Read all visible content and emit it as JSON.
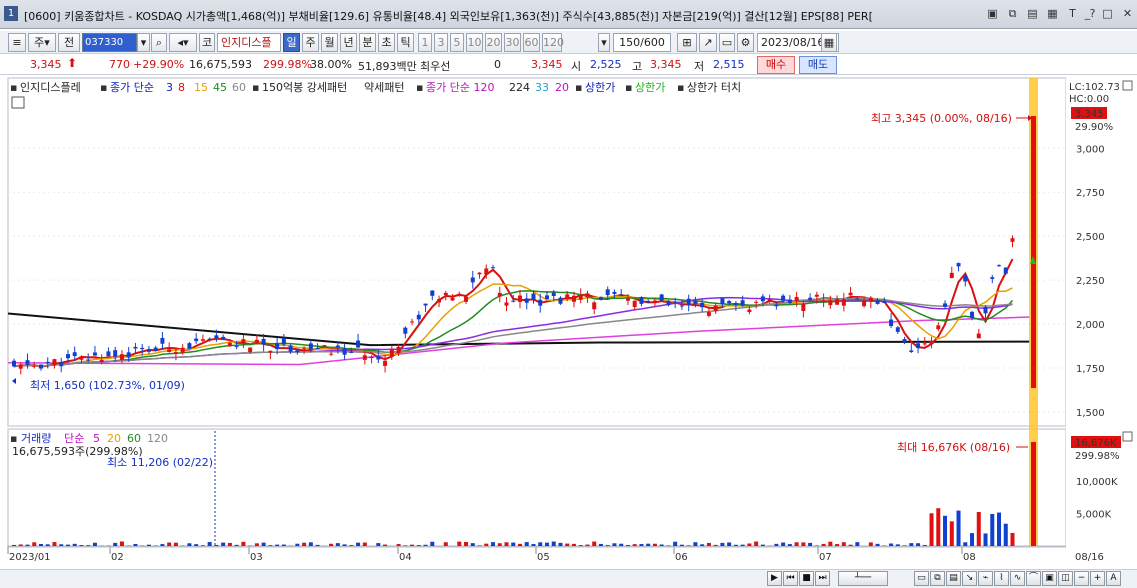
{
  "window": {
    "number": "1",
    "title": "[0600] 키움종합차트 - KOSDAQ 시가총액[1,468(억)] 부채비율[129.6] 유통비율[48.4] 외국인보유[1,363(천)] 주식수[43,885(천)] 자본금[219(억)] 결산[12월] EPS[88] PER["
  },
  "toolbar": {
    "week_label": "주",
    "prev_label": "전",
    "code": "037330",
    "market_label": "코",
    "stock_name": "인지디스플",
    "periods": [
      "일",
      "주",
      "월",
      "년",
      "분",
      "초",
      "틱"
    ],
    "active_period": "일",
    "minute_steps": [
      "1",
      "3",
      "5",
      "10",
      "20",
      "30",
      "60",
      "120"
    ],
    "count": "150/600",
    "date": "2023/08/16"
  },
  "price_row": {
    "price": "3,345",
    "change": "770",
    "change_pct": "+29.90%",
    "volume": "16,675,593",
    "volume_ratio": "299.98%",
    "turnover": "38.00%",
    "amount": "51,893백만",
    "preferred_label": "최우선",
    "preferred_value": "0",
    "ask": "3,345",
    "open_label": "시",
    "open": "2,525",
    "high_label": "고",
    "high": "3,345",
    "low_label": "저",
    "low": "2,515",
    "buy_label": "매수",
    "sell_label": "매도"
  },
  "legend": {
    "stock": "인지디스플레",
    "ma_label": "종가 단순",
    "ma_periods": [
      "3",
      "8",
      "15",
      "45",
      "60"
    ],
    "ma_colors": [
      "#d81010",
      "#e8a000",
      "#228b22",
      "#8a2be2",
      "#888888"
    ],
    "trend_label": "150억봉 강세패턴",
    "weak_label": "약세패턴",
    "ma2_label": "종가 단순 120",
    "ma2_periods": [
      "224",
      "33",
      "20"
    ],
    "limit_up": "상한가",
    "limit_up2": "상한가",
    "limit_up_touch": "상한가 터치"
  },
  "right_labels": {
    "lc": "LC:102.73",
    "hc": "HC:0.00",
    "price_tag": "3,345",
    "pct_tag": "29.90%",
    "vol_tag": "16,676K",
    "vol_pct_tag": "299.98%"
  },
  "annotations": {
    "high": "최고 3,345 (0.00%, 08/16)",
    "low": "최저 1,650 (102.73%, 01/09)",
    "vol_max": "최대 16,676K (08/16)",
    "vol_min": "최소 11,206 (02/22)"
  },
  "volume_legend": {
    "label": "거래량",
    "ma_label": "단순",
    "periods": [
      "5",
      "20",
      "60",
      "120"
    ],
    "value": "16,675,593주(299.98%)"
  },
  "chart_data": {
    "type": "candlestick",
    "price_axis": {
      "ticks": [
        "3,000",
        "2,750",
        "2,500",
        "2,250",
        "2,000",
        "1,750",
        "1,500"
      ],
      "values": [
        3000,
        2750,
        2500,
        2250,
        2000,
        1750,
        1500
      ],
      "range": [
        1420,
        3400
      ]
    },
    "volume_axis": {
      "ticks": [
        "10,000K",
        "5,000K"
      ],
      "values": [
        10000,
        5000
      ],
      "range": [
        0,
        18000
      ]
    },
    "x_labels": [
      "2023/01",
      "02",
      "03",
      "04",
      "05",
      "06",
      "07",
      "08",
      "08/16"
    ],
    "price_high": 3345,
    "price_low": 1650,
    "last_close": 3345
  }
}
